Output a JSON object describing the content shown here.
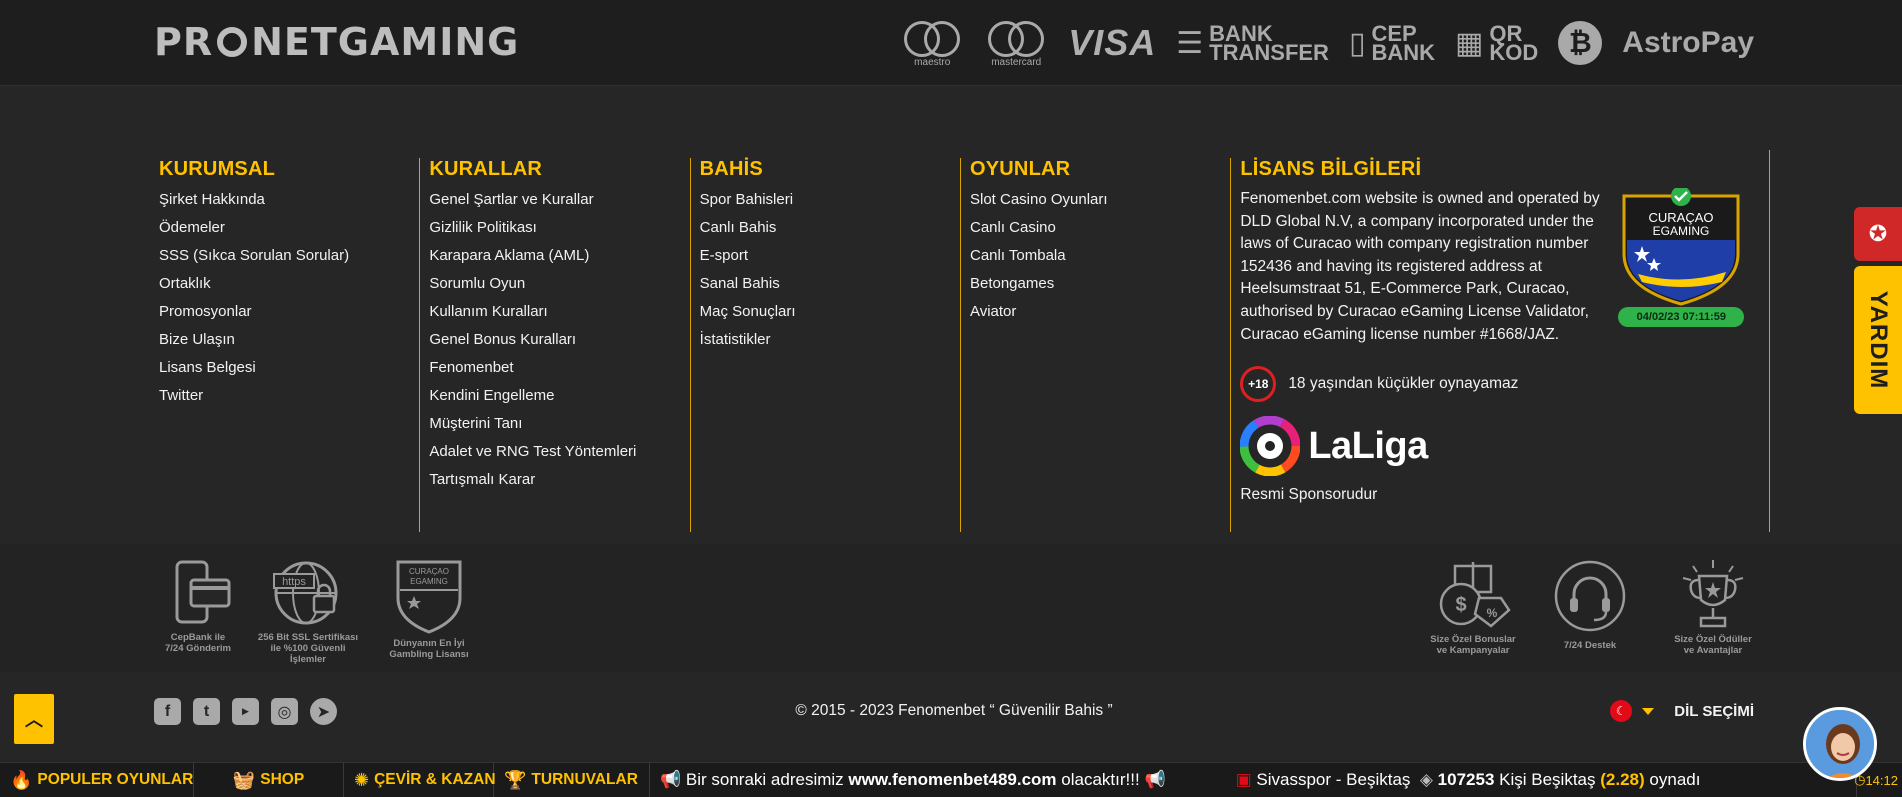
{
  "header": {
    "brand_left": "PR",
    "brand_right": "NETGAMING",
    "payments": [
      {
        "name": "maestro",
        "caption": "maestro"
      },
      {
        "name": "mastercard",
        "caption": "mastercard"
      },
      {
        "name": "visa",
        "text": "VISA"
      },
      {
        "name": "bank-transfer",
        "line1": "BANK",
        "line2": "TRANSFER"
      },
      {
        "name": "cep-bank",
        "line1": "CEP",
        "line2": "BANK"
      },
      {
        "name": "qr-kod",
        "line1": "QR",
        "line2": "KOD"
      },
      {
        "name": "bitcoin",
        "text": "₿"
      },
      {
        "name": "astropay",
        "text": "AstroPay"
      }
    ]
  },
  "columns": {
    "kurumsal": {
      "title": "KURUMSAL",
      "links": [
        "Şirket Hakkında",
        "Ödemeler",
        "SSS (Sıkca Sorulan Sorular)",
        "Ortaklık",
        "Promosyonlar",
        "Bize Ulaşın",
        "Lisans Belgesi",
        "Twitter"
      ]
    },
    "kurallar": {
      "title": "KURALLAR",
      "links": [
        "Genel Şartlar ve Kurallar",
        "Gizlilik Politikası",
        "Karapara Aklama (AML)",
        "Sorumlu Oyun",
        "Kullanım Kuralları",
        "Genel Bonus Kuralları",
        "Fenomenbet",
        "Kendini Engelleme",
        "Müşterini Tanı",
        "Adalet ve RNG Test Yöntemleri",
        "Tartışmalı Karar"
      ]
    },
    "bahis": {
      "title": "BAHİS",
      "links": [
        "Spor Bahisleri",
        "Canlı Bahis",
        "E-sport",
        "Sanal Bahis",
        "Maç Sonuçları",
        "İstatistikler"
      ]
    },
    "oyunlar": {
      "title": "OYUNLAR",
      "links": [
        "Slot Casino Oyunları",
        "Canlı Casino",
        "Canlı Tombala",
        "Betongames",
        "Aviator"
      ]
    },
    "lisans": {
      "title": "LİSANS BİLGİLERİ",
      "text": "Fenomenbet.com website is owned and operated by DLD Global N.V, a company incorporated under the laws of Curacao with company registration number 152436 and having its registered address at Heelsumstraat 51, E-Commerce Park, Curacao, authorised by Curacao eGaming License Validator, Curacao eGaming license number #1668/JAZ.",
      "seal_line1": "CURAÇAO",
      "seal_line2": "EGAMING",
      "seal_date": "04/02/23  07:11:59",
      "age_badge": "+18",
      "age_text": "18 yaşından küçükler oynayamaz",
      "laliga": "LaLiga",
      "sponsor": "Resmi Sponsorudur"
    }
  },
  "badges": {
    "cepbank": {
      "line1": "CepBank ile",
      "line2": "7/24 Gönderim"
    },
    "ssl": {
      "line1": "256 Bit SSL Sertifikası",
      "line2": "ile %100 Güvenli İşlemler",
      "https": "https"
    },
    "license": {
      "line1": "Dünyanın En İyi",
      "line2": "Gambling Lisansı",
      "seal1": "CURAÇAO",
      "seal2": "EGAMING"
    },
    "bonus": {
      "line1": "Size Özel Bonuslar",
      "line2": "ve Kampanyalar"
    },
    "support": {
      "line1": "7/24 Destek"
    },
    "rewards": {
      "line1": "Size Özel Ödüller",
      "line2": "ve Avantajlar"
    }
  },
  "footer": {
    "copyright": "© 2015 - 2023 Fenomenbet “ Güvenilir Bahis ”",
    "language_label": "DİL SEÇİMİ"
  },
  "ticker": {
    "populer": "POPULER OYUNLAR",
    "shop": "SHOP",
    "cevir": "ÇEVİR & KAZAN",
    "turnuva": "TURNUVALAR",
    "msg_pre": "Bir sonraki adresimiz",
    "msg_domain": "www.fenomenbet489.com",
    "msg_post": "olacaktır!!!",
    "match": "Sivasspor - Beşiktaş",
    "count": "107253",
    "bet_text": "Kişi Beşiktaş",
    "odd": "(2.28)",
    "played": "oynadı",
    "time": "14:12"
  },
  "side": {
    "help": "YARDIM"
  },
  "colors": {
    "accent": "#ffc200",
    "background": "#262626",
    "danger": "#d02828"
  }
}
